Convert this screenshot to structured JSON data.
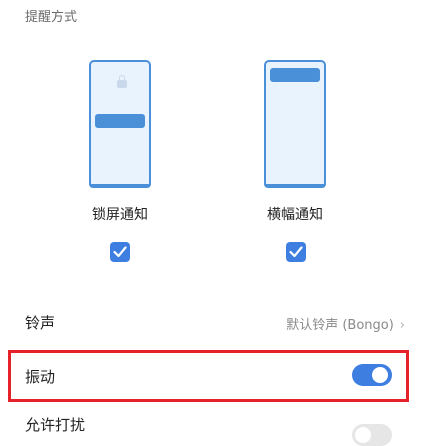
{
  "section": {
    "title": "提醒方式"
  },
  "modes": [
    {
      "label": "锁屏通知",
      "checked": true
    },
    {
      "label": "横幅通知",
      "checked": true
    }
  ],
  "rows": {
    "ringtone": {
      "label": "铃声",
      "value": "默认铃声 (Bongo)",
      "chevron": "›"
    },
    "vibration": {
      "label": "振动",
      "toggle": true
    },
    "allow_dnd": {
      "label": "允许打扰",
      "toggle": false
    }
  },
  "colors": {
    "accent": "#3e7ee0",
    "highlight": "#e5222a"
  }
}
